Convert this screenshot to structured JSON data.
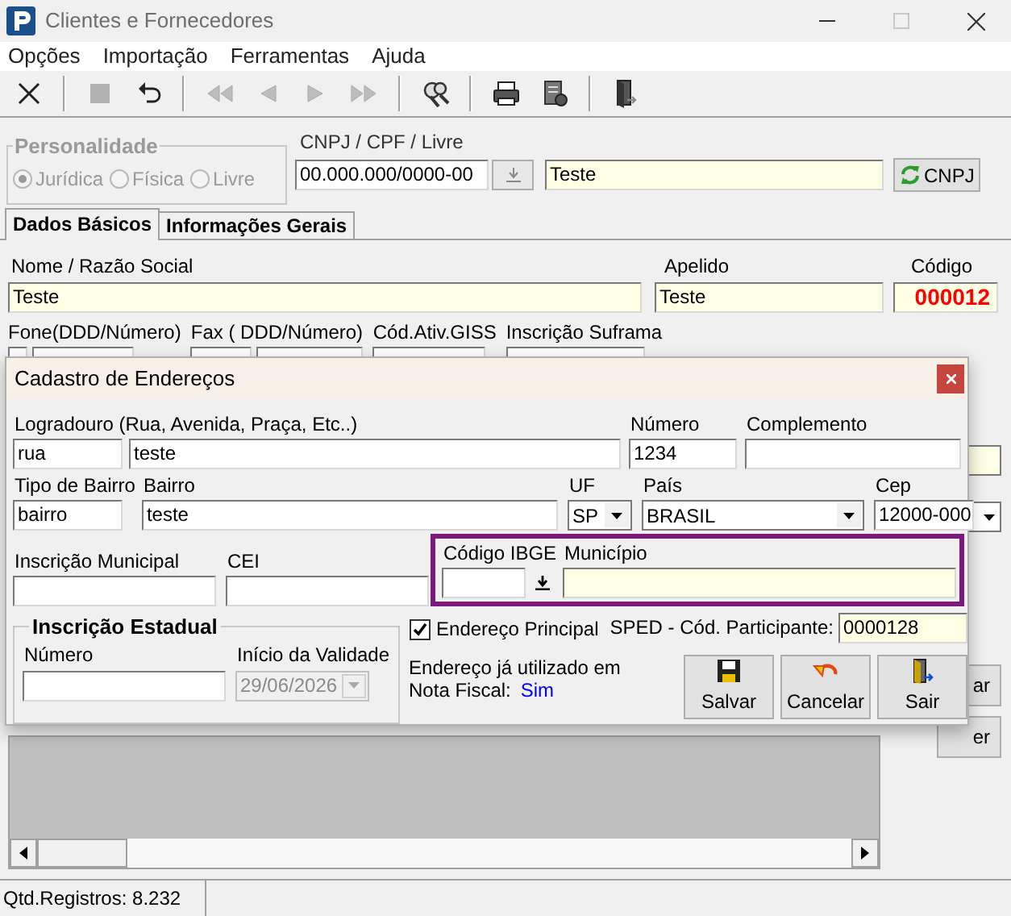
{
  "window": {
    "title": "Clientes e Fornecedores"
  },
  "menu": [
    "Opções",
    "Importação",
    "Ferramentas",
    "Ajuda"
  ],
  "toolbar": [
    {
      "kind": "close",
      "disabled": false
    },
    {
      "kind": "sep"
    },
    {
      "kind": "stop",
      "disabled": true
    },
    {
      "kind": "undo",
      "disabled": false
    },
    {
      "kind": "sep"
    },
    {
      "kind": "first",
      "disabled": true
    },
    {
      "kind": "prev",
      "disabled": true
    },
    {
      "kind": "next",
      "disabled": true
    },
    {
      "kind": "last",
      "disabled": true
    },
    {
      "kind": "sep"
    },
    {
      "kind": "search",
      "disabled": false
    },
    {
      "kind": "sep"
    },
    {
      "kind": "print",
      "disabled": false
    },
    {
      "kind": "report",
      "disabled": false
    },
    {
      "kind": "sep"
    },
    {
      "kind": "exit",
      "disabled": false
    }
  ],
  "personalidade": {
    "legend": "Personalidade",
    "disabled": true,
    "options": [
      {
        "label": "Jurídica",
        "selected": true
      },
      {
        "label": "Física",
        "selected": false
      },
      {
        "label": "Livre",
        "selected": false
      }
    ]
  },
  "cnpj": {
    "label": "CNPJ / CPF / Livre",
    "value": "00.000.000/0000-00",
    "name_value": "Teste",
    "button": "CNPJ"
  },
  "tabs": [
    {
      "label": "Dados Básicos",
      "selected": true
    },
    {
      "label": "Informações Gerais",
      "selected": false
    }
  ],
  "nome": {
    "label": "Nome / Razão Social",
    "value": "Teste"
  },
  "apelido": {
    "label": "Apelido",
    "value": "Teste"
  },
  "codigo": {
    "label": "Código",
    "value": "000012"
  },
  "contact_labels": [
    "Fone(DDD/Número)",
    "Fax ( DDD/Número)",
    "Cód.Ativ.GISS",
    "Inscrição Suframa"
  ],
  "side_buttons": [
    "ar",
    "er"
  ],
  "status_bar": {
    "records": "Qtd.Registros: 8.232"
  },
  "dialog": {
    "title": "Cadastro de Endereços",
    "logradouro": {
      "label": "Logradouro (Rua, Avenida, Praça, Etc..)",
      "type": "rua",
      "value": "teste"
    },
    "numero": {
      "label": "Número",
      "value": "1234"
    },
    "complemento": {
      "label": "Complemento"
    },
    "tipo_bairro": {
      "label": "Tipo de Bairro",
      "value": "bairro"
    },
    "bairro": {
      "label": "Bairro",
      "value": "teste"
    },
    "uf": {
      "label": "UF",
      "value": "SP"
    },
    "pais": {
      "label": "País",
      "value": "BRASIL"
    },
    "cep": {
      "label": "Cep",
      "value": "12000-000"
    },
    "inscricao_municipal": {
      "label": "Inscrição Municipal"
    },
    "cei": {
      "label": "CEI"
    },
    "ibge_highlighted": true,
    "ibge": {
      "label": "Código IBGE"
    },
    "municipio": {
      "label": "Município"
    },
    "inscricao_estadual": {
      "legend": "Inscrição Estadual",
      "numero_label": "Número",
      "validade_label": "Início da Validade",
      "validade_value": "29/06/2026",
      "validade_disabled": true
    },
    "endereco_principal": {
      "label": "Endereço Principal",
      "checked": true
    },
    "sped": {
      "label": "SPED - Cód. Participante:",
      "value": "0000128"
    },
    "nota_fiscal": {
      "text": "Endereço já utilizado em",
      "label": "Nota Fiscal:",
      "value": "Sim"
    },
    "buttons": [
      {
        "kind": "save",
        "label": "Salvar"
      },
      {
        "kind": "cancel",
        "label": "Cancelar"
      },
      {
        "kind": "exit",
        "label": "Sair"
      }
    ]
  }
}
